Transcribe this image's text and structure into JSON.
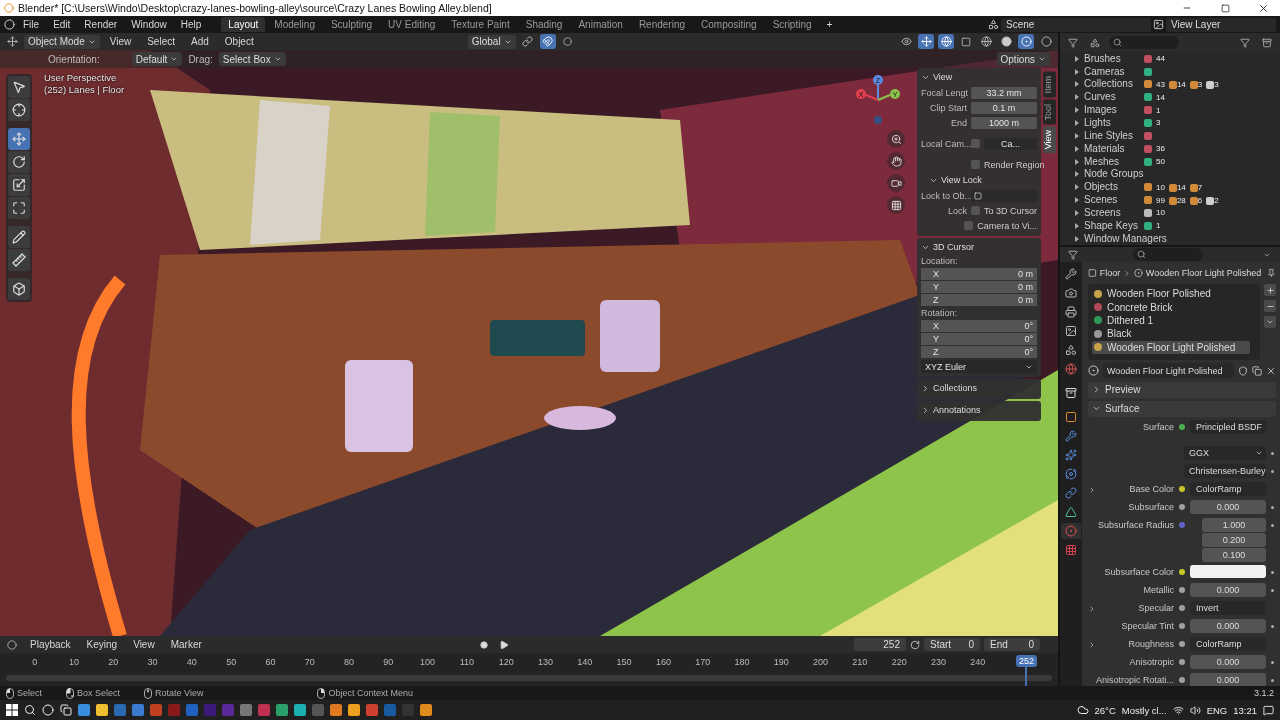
{
  "title_bar": {
    "title": "Blender* [C:\\Users\\Windo\\Desktop\\crazy-lanes-bowling-alley\\source\\Crazy Lanes Bowling Alley.blend]"
  },
  "menu": [
    "File",
    "Edit",
    "Render",
    "Window",
    "Help"
  ],
  "workspaces": [
    {
      "label": "Layout",
      "selected": true
    },
    {
      "label": "Modeling",
      "selected": false
    },
    {
      "label": "Sculpting",
      "selected": false
    },
    {
      "label": "UV Editing",
      "selected": false
    },
    {
      "label": "Texture Paint",
      "selected": false
    },
    {
      "label": "Shading",
      "selected": false
    },
    {
      "label": "Animation",
      "selected": false
    },
    {
      "label": "Rendering",
      "selected": false
    },
    {
      "label": "Compositing",
      "selected": false
    },
    {
      "label": "Scripting",
      "selected": false
    }
  ],
  "add_workspace": "+",
  "scene": "Scene",
  "view_layer": "View Layer",
  "viewport": {
    "mode": "Object Mode",
    "menus": [
      "View",
      "Select",
      "Add",
      "Object"
    ],
    "orientation": "Global",
    "tool_settings": {
      "orientation_label": "Orientation:",
      "orientation": "Default",
      "drag_label": "Drag:",
      "drag": "Select Box",
      "options": "Options"
    },
    "tools": [
      {
        "kind": "select",
        "selected": false
      },
      {
        "kind": "cursor",
        "selected": false
      },
      {
        "kind": "move",
        "selected": true
      },
      {
        "kind": "rotate",
        "selected": false
      },
      {
        "kind": "scale",
        "selected": false
      },
      {
        "kind": "transform",
        "selected": false
      },
      {
        "kind": "annotate",
        "selected": false
      },
      {
        "kind": "measure",
        "selected": false
      },
      {
        "kind": "add-cube",
        "selected": false
      }
    ],
    "overlay_text": [
      "User Perspective",
      "(252) Lanes | Floor"
    ],
    "axes": [
      "Z",
      "X",
      "Y"
    ],
    "sidebar": {
      "tabs": [
        {
          "label": "Item",
          "selected": false
        },
        {
          "label": "Tool",
          "selected": false
        },
        {
          "label": "View",
          "selected": true
        }
      ],
      "view_panel": {
        "title": "View",
        "expanded": true,
        "fields": [
          {
            "label": "Focal Lengt",
            "value": "33.2 mm"
          },
          {
            "label": "Clip Start",
            "value": "0.1 m"
          },
          {
            "label": "End",
            "value": "1000 m"
          }
        ],
        "local_camera": {
          "label": "Local Cam...",
          "checked": false,
          "value": "Ca..."
        },
        "render_region": {
          "label": "Render Region",
          "checked": false
        },
        "view_lock": {
          "title": "View Lock",
          "expanded": true,
          "lock_object_label": "Lock to Ob...",
          "lock_label": "Lock",
          "options": [
            {
              "label": "To 3D Cursor",
              "checked": false
            },
            {
              "label": "Camera to Vi...",
              "checked": false
            }
          ]
        }
      },
      "cursor_panel": {
        "title": "3D Cursor",
        "expanded": true,
        "location_label": "Location:",
        "location": [
          {
            "axis": "X",
            "value": "0 m"
          },
          {
            "axis": "Y",
            "value": "0 m"
          },
          {
            "axis": "Z",
            "value": "0 m"
          }
        ],
        "rotation_label": "Rotation:",
        "rotation": [
          {
            "axis": "X",
            "value": "0°"
          },
          {
            "axis": "Y",
            "value": "0°"
          },
          {
            "axis": "Z",
            "value": "0°"
          }
        ],
        "mode": "XYZ Euler"
      },
      "collapsed_panels": [
        {
          "title": "Collections",
          "expanded": false
        },
        {
          "title": "Annotations",
          "expanded": false
        }
      ]
    }
  },
  "timeline": {
    "menus": [
      "Playback",
      "Keying",
      "View",
      "Marker"
    ],
    "current": "252",
    "start_label": "Start",
    "start": "0",
    "end_label": "End",
    "end": "0",
    "ticks": [
      "0",
      "10",
      "20",
      "30",
      "40",
      "50",
      "60",
      "70",
      "80",
      "90",
      "100",
      "110",
      "120",
      "130",
      "140",
      "150",
      "160",
      "170",
      "180",
      "190",
      "200",
      "210",
      "220",
      "230",
      "240"
    ],
    "playhead": "252"
  },
  "outliner": {
    "items": [
      {
        "label": "Brushes",
        "expanded": false,
        "icon": true,
        "counts": [
          "44"
        ]
      },
      {
        "label": "Cameras",
        "expanded": false,
        "icon": true
      },
      {
        "label": "Collections",
        "expanded": false,
        "icon": true,
        "counts": [
          "43",
          "14",
          "3",
          "3"
        ]
      },
      {
        "label": "Curves",
        "expanded": false,
        "icon": true,
        "counts": [
          "14"
        ]
      },
      {
        "label": "Images",
        "expanded": false,
        "icon": true,
        "counts": [
          "1"
        ]
      },
      {
        "label": "Lights",
        "expanded": false,
        "icon": true,
        "counts": [
          "3"
        ]
      },
      {
        "label": "Line Styles",
        "expanded": false,
        "icon": true
      },
      {
        "label": "Materials",
        "expanded": false,
        "icon": true,
        "counts": [
          "36"
        ]
      },
      {
        "label": "Meshes",
        "expanded": false,
        "icon": true,
        "counts": [
          "50"
        ]
      },
      {
        "label": "Node Groups",
        "expanded": false,
        "icon": false
      },
      {
        "label": "Objects",
        "expanded": false,
        "icon": true,
        "counts": [
          "10",
          "14",
          "7"
        ]
      },
      {
        "label": "Scenes",
        "expanded": false,
        "icon": true,
        "counts": [
          "99",
          "28",
          "6",
          "2"
        ]
      },
      {
        "label": "Screens",
        "expanded": false,
        "icon": true,
        "counts": [
          "10"
        ]
      },
      {
        "label": "Shape Keys",
        "expanded": false,
        "icon": true,
        "counts": [
          "1"
        ]
      },
      {
        "label": "Window Managers",
        "expanded": false,
        "icon": false
      }
    ]
  },
  "properties": {
    "tabs": [
      {
        "kind": "tool",
        "selected": false
      },
      {
        "kind": "render",
        "selected": false
      },
      {
        "kind": "output",
        "selected": false
      },
      {
        "kind": "view-layer",
        "selected": false
      },
      {
        "kind": "scene",
        "selected": false
      },
      {
        "kind": "world",
        "selected": false
      },
      {
        "kind": "collection",
        "selected": false
      },
      {
        "kind": "object",
        "selected": false
      },
      {
        "kind": "modifiers",
        "selected": false
      },
      {
        "kind": "particles",
        "selected": false
      },
      {
        "kind": "physics",
        "selected": false
      },
      {
        "kind": "constraints",
        "selected": false
      },
      {
        "kind": "data",
        "selected": false
      },
      {
        "kind": "material",
        "selected": true
      },
      {
        "kind": "texture",
        "selected": false
      }
    ],
    "breadcrumb": [
      "Floor",
      "Wooden Floor Light Polished"
    ],
    "slots": [
      {
        "label": "Wooden Floor Polished",
        "color": "#c8a24a",
        "selected": false
      },
      {
        "label": "Concrete Brick",
        "color": "#b04a5a",
        "selected": false
      },
      {
        "label": "Dithered 1",
        "color": "#2e9a5a",
        "selected": false
      },
      {
        "label": "Black",
        "color": "#9a9a9a",
        "selected": false
      },
      {
        "label": "Wooden Floor Light Polished",
        "color": "#c8a24a",
        "selected": true
      }
    ],
    "material": "Wooden Floor Light Polished",
    "panels": [
      {
        "title": "Preview",
        "expanded": false
      },
      {
        "title": "Surface",
        "expanded": true
      }
    ],
    "rows": [
      {
        "kind": "link",
        "label": "Surface",
        "value": "Principled BSDF",
        "color": "#4caf50"
      },
      {
        "kind": "dropdown",
        "value": "GGX"
      },
      {
        "kind": "dropdown",
        "value": "Christensen-Burley"
      },
      {
        "kind": "link",
        "label": "Base Color",
        "value": "ColorRamp",
        "color": "#c7c729",
        "expandable": true
      },
      {
        "kind": "number",
        "label": "Subsurface",
        "value": "0.000",
        "color": "#a1a1a1"
      },
      {
        "kind": "vector",
        "label": "Subsurface Radius",
        "values": [
          "1.000",
          "0.200",
          "0.100"
        ],
        "color": "#6363c7"
      },
      {
        "kind": "swatch",
        "label": "Subsurface Color",
        "color": "#f2f2f2"
      },
      {
        "kind": "number",
        "label": "Metallic",
        "value": "0.000",
        "color": "#a1a1a1"
      },
      {
        "kind": "link",
        "label": "Specular",
        "value": "Invert",
        "color": "#a1a1a1",
        "expandable": true
      },
      {
        "kind": "number",
        "label": "Specular Tint",
        "value": "0.000",
        "color": "#a1a1a1"
      },
      {
        "kind": "link",
        "label": "Roughness",
        "value": "ColorRamp",
        "color": "#a1a1a1",
        "expandable": true
      },
      {
        "kind": "number",
        "label": "Anisotropic",
        "value": "0.000",
        "color": "#a1a1a1"
      },
      {
        "kind": "number",
        "label": "Anisotropic Rotati...",
        "value": "0.000",
        "color": "#a1a1a1"
      }
    ]
  },
  "status_bar": {
    "items": [
      {
        "kind": "mouse-left",
        "label": "Select"
      },
      {
        "kind": "mouse-drag",
        "label": "Box Select"
      },
      {
        "kind": "mouse-middle",
        "label": "Rotate View"
      },
      {
        "kind": "mouse-right",
        "label": "Object Context Menu"
      }
    ],
    "version": "3.1.2"
  },
  "taskbar": {
    "weather": "26°C",
    "weather_desc": "Mostly cl...",
    "language": "ENG",
    "time": "13:21"
  }
}
